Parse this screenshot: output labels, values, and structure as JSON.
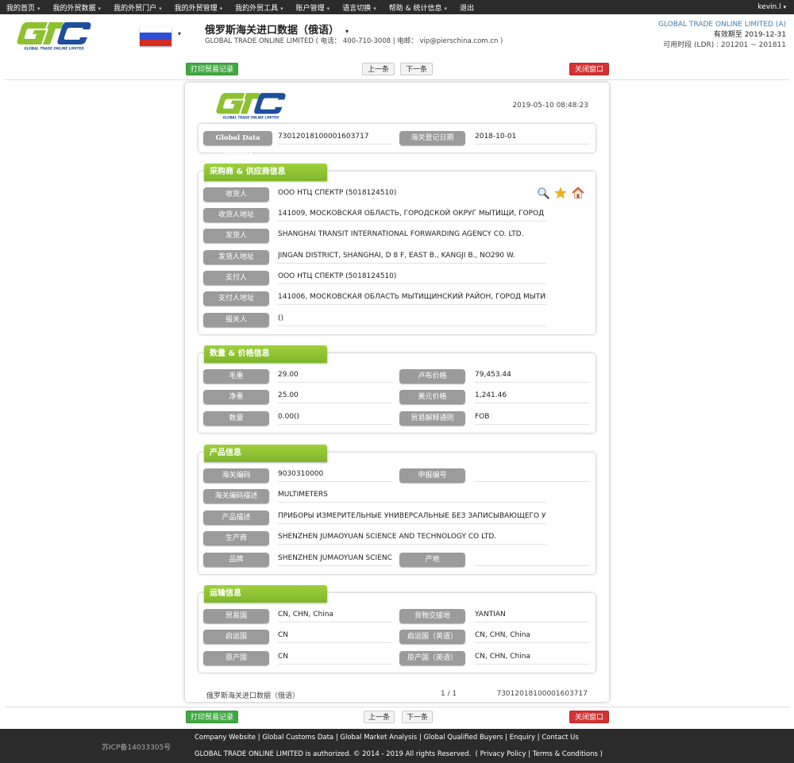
{
  "topnav": {
    "items": [
      {
        "label": "我的首页"
      },
      {
        "label": "我的外贸数据"
      },
      {
        "label": "我的外贸门户"
      },
      {
        "label": "我的外贸管理"
      },
      {
        "label": "我的外贸工具"
      },
      {
        "label": "账户管理"
      },
      {
        "label": "语言切换"
      },
      {
        "label": "帮助 & 统计信息"
      },
      {
        "label": "退出"
      }
    ],
    "user": "kevin.l"
  },
  "header": {
    "logo_text": "GLOBAL TRADE ONLINE LIMITED",
    "title": "俄罗斯海关进口数据（俄语）",
    "subtitle": "GLOBAL TRADE ONLINE LIMITED ( 电话： 400-710-3008 | 电邮： vip@pierschina.com.cn )",
    "company": "GLOBAL TRADE ONLINE LIMITED (A)",
    "valid_until": "有效期至 2019-12-31",
    "period": "可用时段 (LDR) : 201201 ~ 201811"
  },
  "toolbar": {
    "print_label": "打印贸易记录",
    "prev_label": "上一条",
    "next_label": "下一条",
    "close_label": "关闭窗口"
  },
  "record": {
    "timestamp": "2019-05-10 08:48:23",
    "identity_label": "Global Data Identity",
    "identity_value": "73012018100001603717",
    "reg_date_label": "海关登记日期",
    "reg_date_value": "2018-10-01"
  },
  "parties": {
    "title": "采购商 & 供应商信息",
    "rows": [
      {
        "label": "收货人",
        "value": "ООО НТЦ СПЕКТР (5018124510)"
      },
      {
        "label": "收货人地址",
        "value": "141009, МОСКОВСКАЯ ОБЛАСТЬ, ГОРОДСКОЙ ОКРУГ МЫТИЩИ, ГОРОД МЫТИЩ"
      },
      {
        "label": "发货人",
        "value": "SHANGHAI TRANSIT INTERNATIONAL FORWARDING AGENCY CO. LTD."
      },
      {
        "label": "发货人地址",
        "value": "JINGAN DISTRICT, SHANGHAI, D 8 F, EAST B., KANGJI B., NO290 W."
      },
      {
        "label": "支付人",
        "value": "ООО НТЦ СПЕКТР  (5018124510)"
      },
      {
        "label": "支付人地址",
        "value": "141006, МОСКОВСКАЯ ОБЛАСТЬ МЫТИЩИНСКИЙ РАЙОН, ГОРОД МЫТИЩИ, ОЛ"
      },
      {
        "label": "报关人",
        "value": "()"
      }
    ]
  },
  "quantity": {
    "title": "数量 & 价格信息",
    "left": [
      {
        "label": "毛重",
        "value": "29.00"
      },
      {
        "label": "净重",
        "value": "25.00"
      },
      {
        "label": "数量",
        "value": "0.00()"
      }
    ],
    "right": [
      {
        "label": "卢布价格",
        "value": "79,453.44"
      },
      {
        "label": "美元价格",
        "value": "1,241.46"
      },
      {
        "label": "贸易解释通则",
        "value": "FOB"
      }
    ]
  },
  "product": {
    "title": "产品信息",
    "hs_code_label": "海关编码",
    "hs_code_value": "9030310000",
    "declaration_label": "申报编号",
    "declaration_value": "",
    "hs_desc_label": "海关编码描述",
    "hs_desc_value": "MULTIMETERS",
    "desc_label": "产品描述",
    "desc_value": "ПРИБОРЫ ИЗМЕРИТЕЛЬНЫЕ УНИВЕРСАЛЬНЫЕ БЕЗ ЗАПИСЫВАЮЩЕГО УСТР",
    "manufacturer_label": "生产商",
    "manufacturer_value": "SHENZHEN JUMAOYUAN SCIENCE AND TECHNOLOGY CO LTD.",
    "brand_label": "品牌",
    "brand_value": "SHENZHEN JUMAOYUAN SCIENCE",
    "origin_place_label": "产地",
    "origin_place_value": ""
  },
  "transport": {
    "title": "运输信息",
    "left": [
      {
        "label": "贸易国",
        "value": "CN, CHN, China"
      },
      {
        "label": "启运国",
        "value": "CN"
      },
      {
        "label": "原产国",
        "value": "CN"
      }
    ],
    "right": [
      {
        "label": "货物交接地",
        "value": "YANTIAN"
      },
      {
        "label": "启运国（英语）",
        "value": "CN, CHN, China"
      },
      {
        "label": "原产国（英语）",
        "value": "CN, CHN, China"
      }
    ]
  },
  "card_footer": {
    "source": "俄罗斯海关进口数据（俄语）",
    "page": "1 / 1",
    "id": "73012018100001603717"
  },
  "footer": {
    "icp": "苏ICP备14033305号",
    "links": [
      "Company Website",
      "Global Customs Data",
      "Global Market Analysis",
      "Global Qualified Buyers",
      "Enquiry",
      "Contact Us"
    ],
    "copyright": "GLOBAL TRADE ONLINE LIMITED is authorized. © 2014 - 2019 All rights Reserved.",
    "privacy": "Privacy Policy",
    "terms": "Terms & Conditions"
  },
  "colors": {
    "green_accent": "#8dc131",
    "logo_blue": "#1f4f9c",
    "close_red": "#d43232",
    "label_gray": "#9b9b9b"
  }
}
